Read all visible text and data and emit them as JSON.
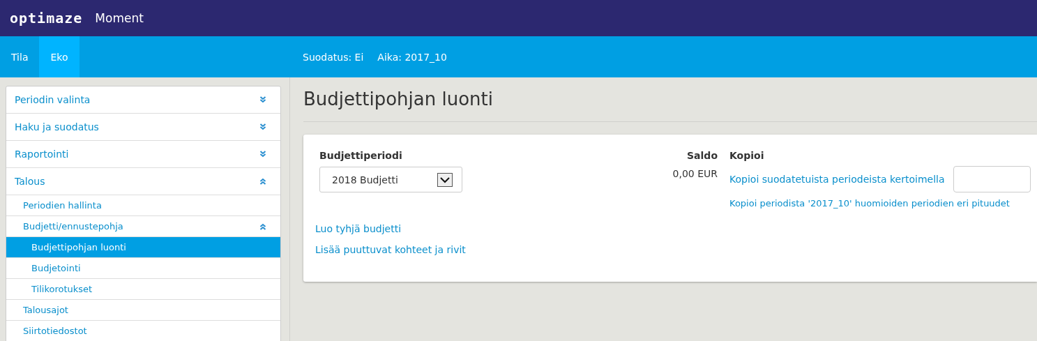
{
  "header": {
    "logo": "optimaze",
    "app_name": "Moment"
  },
  "tabs": [
    {
      "label": "Tila",
      "selected": false
    },
    {
      "label": "Eko",
      "selected": true
    }
  ],
  "nav_info": [
    "Suodatus: Ei",
    "Aika: 2017_10"
  ],
  "sidebar": {
    "items": [
      {
        "label": "Periodin valinta",
        "expanded": false,
        "selected": false
      },
      {
        "label": "Haku ja suodatus",
        "expanded": false,
        "selected": false
      },
      {
        "label": "Raportointi",
        "expanded": false,
        "selected": false
      },
      {
        "label": "Talous",
        "expanded": true,
        "selected": false,
        "children": [
          {
            "label": "Periodien hallinta",
            "selected": false
          },
          {
            "label": "Budjetti/ennustepohja",
            "expanded": true,
            "selected": false,
            "children": [
              {
                "label": "Budjettipohjan luonti",
                "selected": true
              },
              {
                "label": "Budjetointi",
                "selected": false
              },
              {
                "label": "Tilikorotukset",
                "selected": false
              }
            ]
          },
          {
            "label": "Talousajot",
            "selected": false
          },
          {
            "label": "Siirtotiedostot",
            "selected": false
          }
        ]
      }
    ]
  },
  "page_title": "Budjettipohjan luonti",
  "card": {
    "period": {
      "label": "Budjettiperiodi",
      "value": "2018 Budjetti"
    },
    "links": [
      "Luo tyhjä budjetti",
      "Lisää puuttuvat kohteet ja rivit"
    ],
    "saldo": {
      "label": "Saldo",
      "value": "0,00 EUR"
    },
    "copy": {
      "label": "Kopioi",
      "multiplier_link": "Kopioi suodatetuista periodeista kertoimella",
      "period_link": "Kopioi periodista '2017_10' huomioiden periodien eri pituudet"
    }
  }
}
